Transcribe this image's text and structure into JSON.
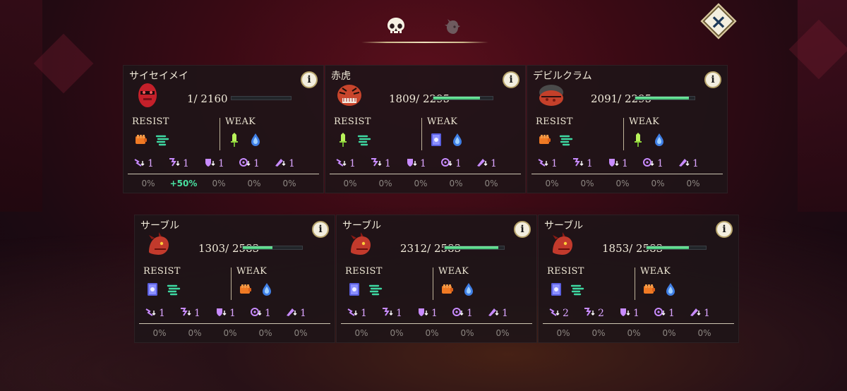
{
  "tabs": [
    {
      "icon": "skull-icon",
      "active": true
    },
    {
      "icon": "hero-head-icon",
      "active": false
    }
  ],
  "close_label": "×",
  "info_label": "i",
  "labels": {
    "resist": "RESIST",
    "weak": "WEAK"
  },
  "enemies": [
    {
      "name": "サイセイメイ",
      "hp_text": "1/ 2160",
      "hp_fraction": 0.0005,
      "avatar": "red-mask-icon",
      "resist": [
        "fist-icon",
        "wind-icon"
      ],
      "weak": [
        "sword-icon",
        "water-icon"
      ],
      "debuffs": [
        "1",
        "1",
        "1",
        "1",
        "1"
      ],
      "pcts": [
        "0%",
        "+50%",
        "0%",
        "0%",
        "0%"
      ]
    },
    {
      "name": "赤虎",
      "hp_text": "1809/ 2295",
      "hp_fraction": 0.79,
      "avatar": "red-tiger-icon",
      "resist": [
        "sword-icon",
        "wind-icon"
      ],
      "weak": [
        "rune-book-icon",
        "water-icon"
      ],
      "debuffs": [
        "1",
        "1",
        "1",
        "1",
        "1"
      ],
      "pcts": [
        "0%",
        "0%",
        "0%",
        "0%",
        "0%"
      ]
    },
    {
      "name": "デビルクラム",
      "hp_text": "2091/ 2295",
      "hp_fraction": 0.91,
      "avatar": "clam-icon",
      "resist": [
        "fist-icon",
        "wind-icon"
      ],
      "weak": [
        "sword-icon",
        "water-icon"
      ],
      "debuffs": [
        "1",
        "1",
        "1",
        "1",
        "1"
      ],
      "pcts": [
        "0%",
        "0%",
        "0%",
        "0%",
        "0%"
      ]
    },
    {
      "name": "サーブル",
      "hp_text": "1303/ 2583",
      "hp_fraction": 0.5,
      "avatar": "red-dragon-icon",
      "resist": [
        "rune-book-icon",
        "wind-icon"
      ],
      "weak": [
        "fist-icon",
        "water-icon"
      ],
      "debuffs": [
        "1",
        "1",
        "1",
        "1",
        "1"
      ],
      "pcts": [
        "0%",
        "0%",
        "0%",
        "0%",
        "0%"
      ]
    },
    {
      "name": "サーブル",
      "hp_text": "2312/ 2583",
      "hp_fraction": 0.9,
      "avatar": "red-dragon-icon",
      "resist": [
        "rune-book-icon",
        "wind-icon"
      ],
      "weak": [
        "fist-icon",
        "water-icon"
      ],
      "debuffs": [
        "1",
        "1",
        "1",
        "1",
        "1"
      ],
      "pcts": [
        "0%",
        "0%",
        "0%",
        "0%",
        "0%"
      ]
    },
    {
      "name": "サーブル",
      "hp_text": "1853/ 2583",
      "hp_fraction": 0.72,
      "avatar": "red-dragon-icon",
      "resist": [
        "rune-book-icon",
        "wind-icon"
      ],
      "weak": [
        "fist-icon",
        "water-icon"
      ],
      "debuffs": [
        "2",
        "2",
        "1",
        "1",
        "1"
      ],
      "pcts": [
        "0%",
        "0%",
        "0%",
        "0%",
        "0%"
      ]
    }
  ],
  "colors": {
    "hp_fill": "#3cbf72",
    "debuff": "#d9a4ff",
    "highlight_pct": "#48e0a0",
    "panel": "#1e1418"
  }
}
